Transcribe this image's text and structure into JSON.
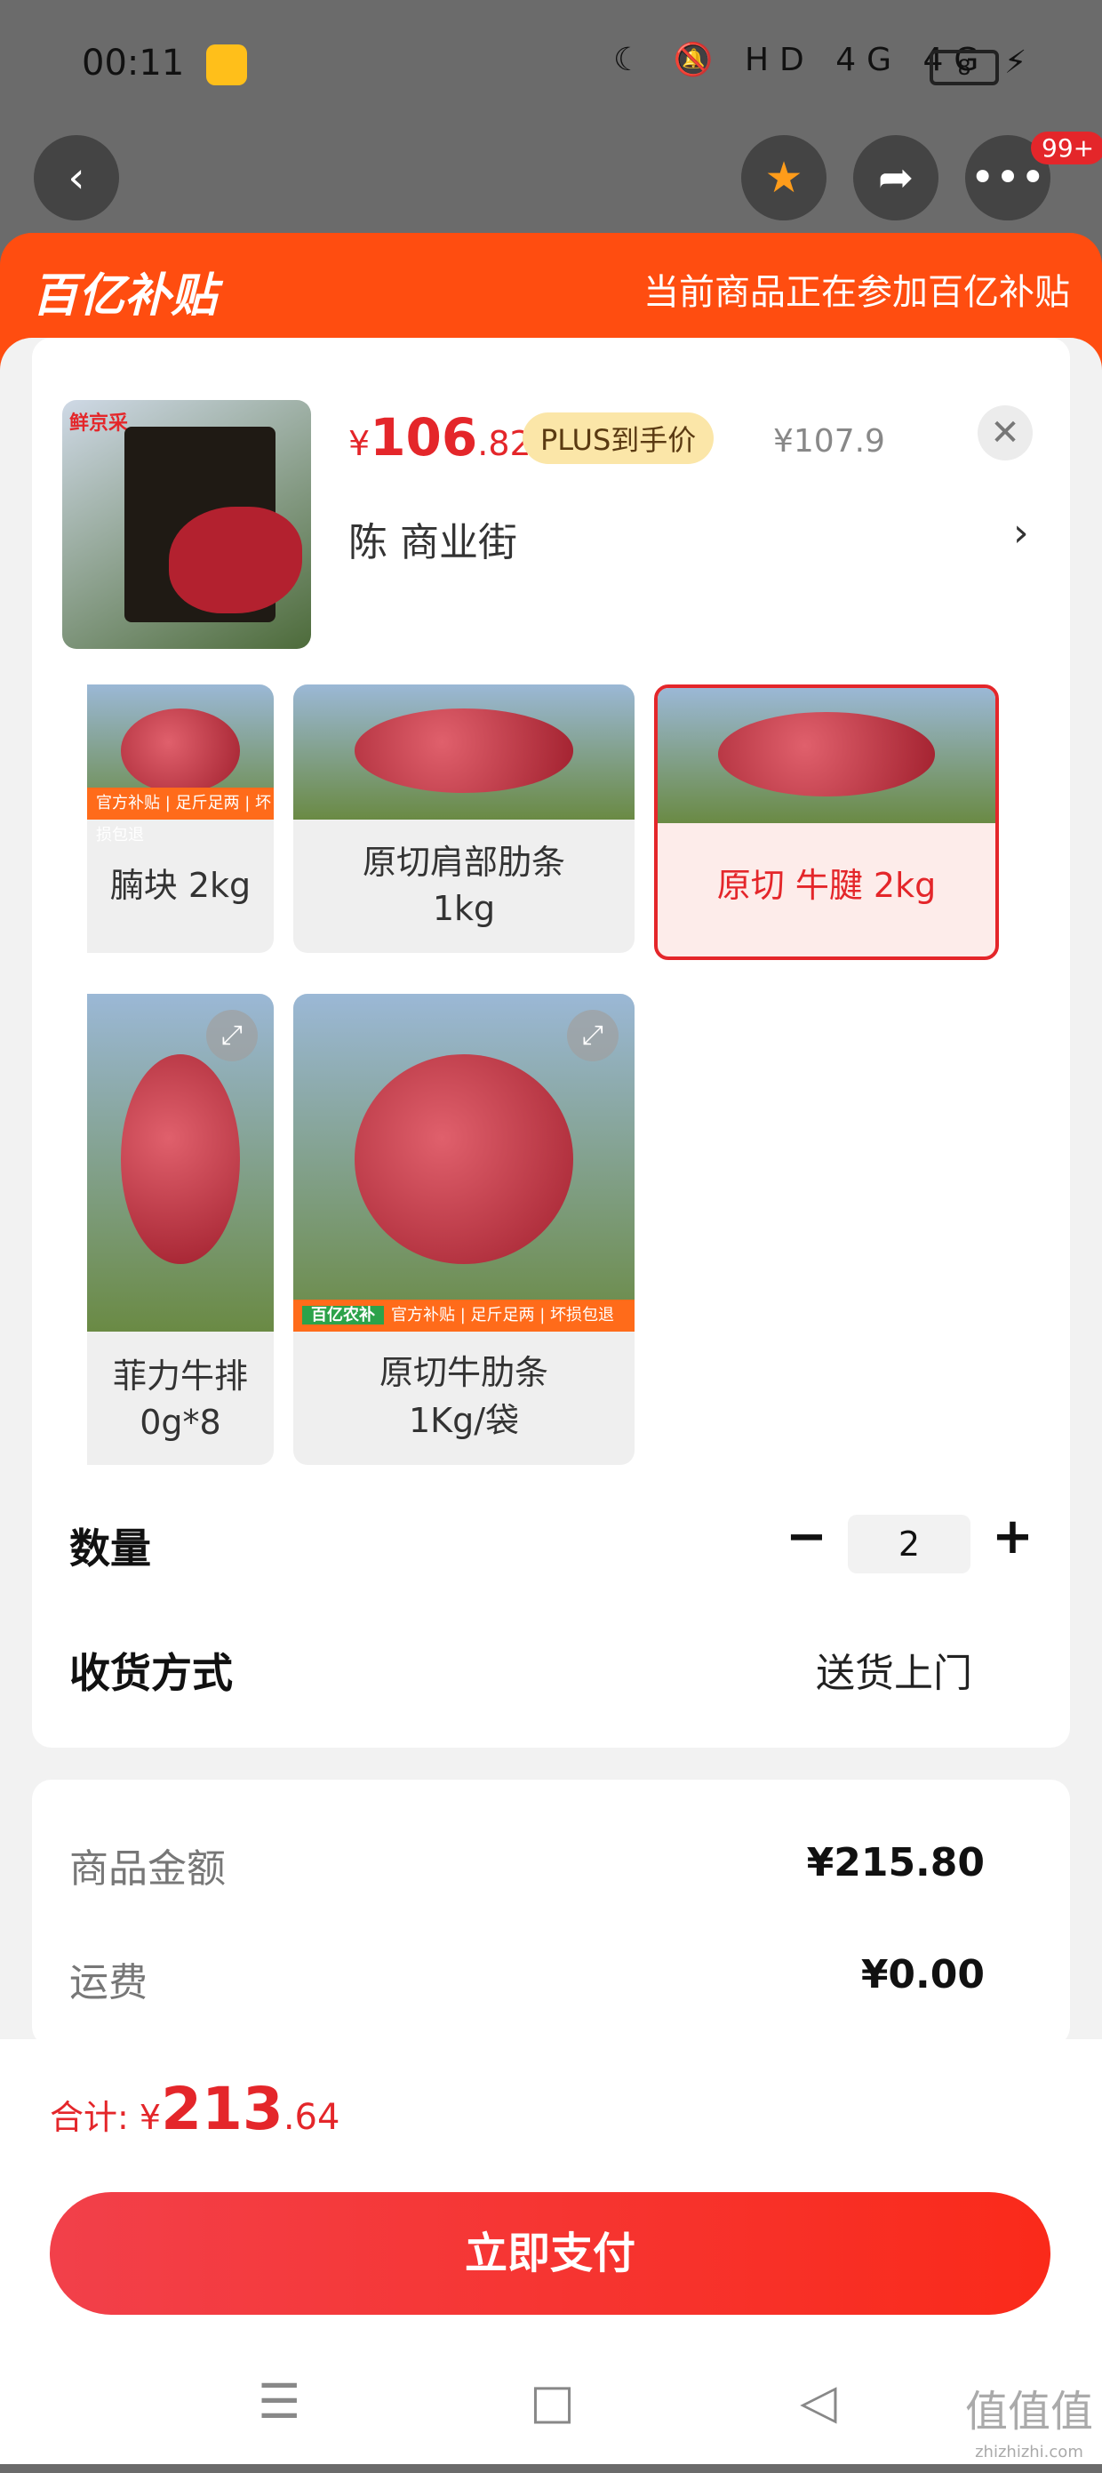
{
  "status_bar": {
    "time": "00:11",
    "network": "HD 4G 4G",
    "battery": "8"
  },
  "top_actions": {
    "back_icon": "chevron-left-icon",
    "badge": "99+"
  },
  "banner": {
    "logo": "百亿补贴",
    "text": "当前商品正在参加百亿补贴"
  },
  "product": {
    "thumb_brand": "鲜京采",
    "price_symbol": "¥",
    "price_int": "106",
    "price_dec": ".82",
    "plus_label": "PLUS到手价",
    "original_price": "¥107.9",
    "address": "陈  商业街"
  },
  "variants": [
    {
      "label": "腩块 2kg",
      "selected": false
    },
    {
      "label": "原切肩部肋条 1kg",
      "selected": false
    },
    {
      "label": "原切 牛腱 2kg",
      "selected": true
    },
    {
      "label": "菲力牛排 0g*8",
      "selected": false
    },
    {
      "label": "原切牛肋条 1Kg/袋",
      "selected": false
    }
  ],
  "variant_lines": {
    "v0": "腩块 2kg",
    "v1a": "原切肩部肋条",
    "v1b": "1kg",
    "v2": "原切 牛腱 2kg",
    "v3a": "菲力牛排",
    "v3b": "0g*8",
    "v4a": "原切牛肋条",
    "v4b": "1Kg/袋"
  },
  "strip": {
    "tag": "百亿农补",
    "items": "官方补贴 | 足斤足两 | 坏损包退"
  },
  "quantity": {
    "label": "数量",
    "minus": "−",
    "value": "2",
    "plus": "+"
  },
  "delivery": {
    "label": "收货方式",
    "value": "送货上门"
  },
  "summary": {
    "goods_label": "商品金额",
    "goods_value": "¥215.80",
    "shipping_label": "运费",
    "shipping_value": "¥0.00"
  },
  "footer": {
    "total_label": "合计: ¥",
    "total_int": "213",
    "total_dec": ".64",
    "pay_button": "立即支付"
  },
  "nav": {
    "menu": "☰",
    "home": "□",
    "back": "◁"
  },
  "watermark": {
    "main": "值值值",
    "sub": "zhizhizhi.com"
  },
  "colors": {
    "accent": "#e4262a",
    "banner": "#ff4d10",
    "plus_badge": "#fbe6a8"
  }
}
